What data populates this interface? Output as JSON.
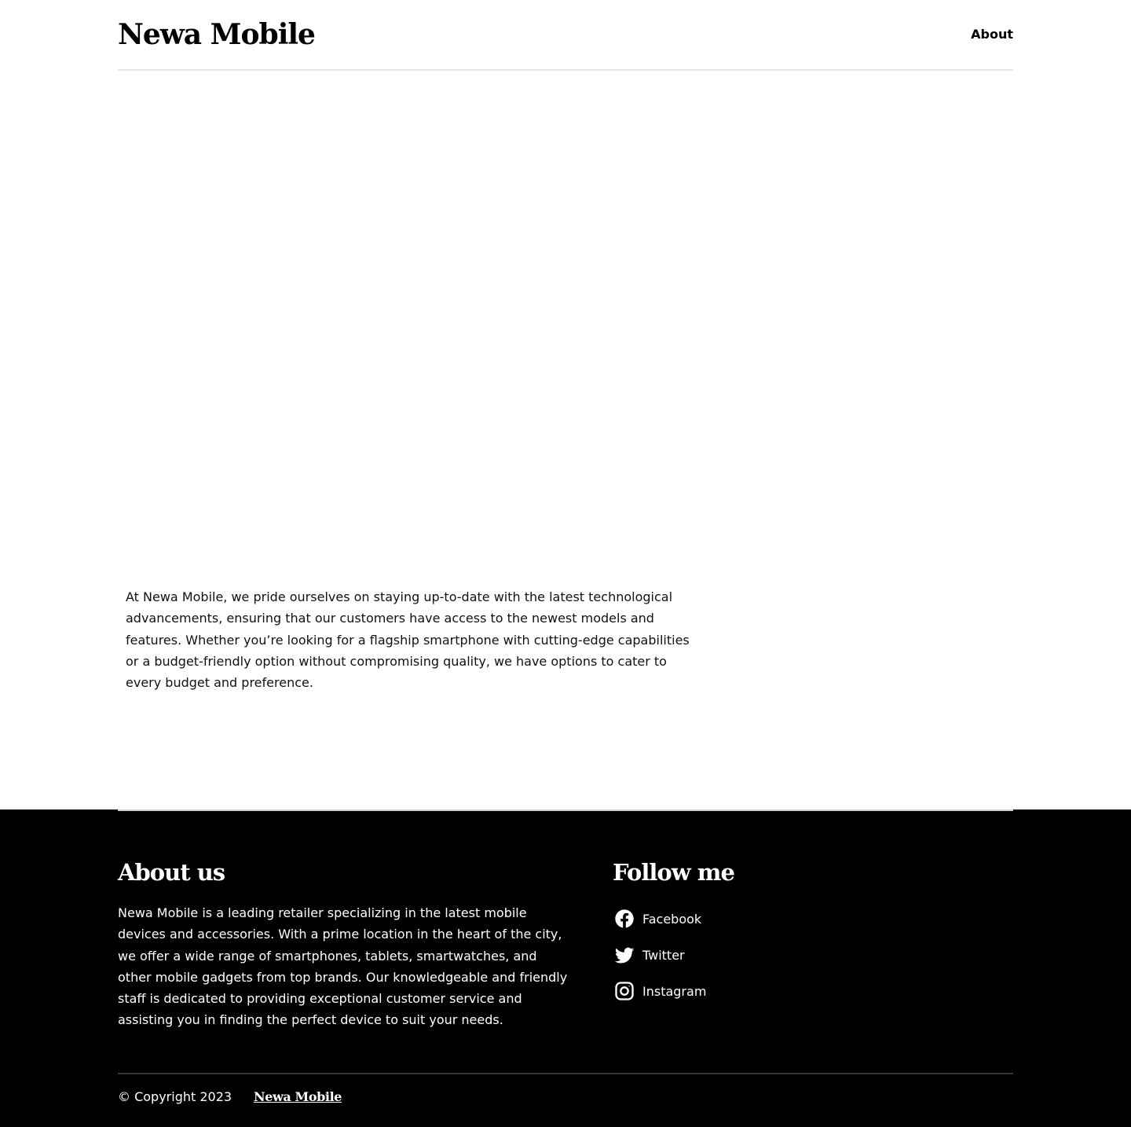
{
  "header": {
    "brand": "Newa Mobile",
    "nav": [
      {
        "label": "About"
      }
    ]
  },
  "main": {
    "intro_text": "At Newa Mobile, we pride ourselves on staying up-to-date with the latest technological advancements, ensuring that our customers have access to the newest models and features. Whether you’re looking for a flagship smartphone with cutting-edge capabilities or a budget-friendly option without compromising quality, we have options to cater to every budget and preference."
  },
  "footer": {
    "about_title": "About us",
    "about_text": "Newa Mobile is a leading retailer specializing in the latest mobile devices and accessories. With a prime location in the heart of the city, we offer a wide range of smartphones, tablets, smartwatches, and other mobile gadgets from top brands. Our knowledgeable and friendly staff is dedicated to providing exceptional customer service and assisting you in finding the perfect device to suit your needs.",
    "follow_title": "Follow me",
    "social": [
      {
        "label": "Facebook",
        "icon": "facebook-icon"
      },
      {
        "label": "Twitter",
        "icon": "twitter-icon"
      },
      {
        "label": "Instagram",
        "icon": "instagram-icon"
      }
    ],
    "copyright": "© Copyright 2023",
    "brand": "Newa Mobile"
  },
  "colors": {
    "background": "#ffffff",
    "footer_background": "#000000",
    "text": "#000000",
    "footer_text": "#ffffff"
  }
}
